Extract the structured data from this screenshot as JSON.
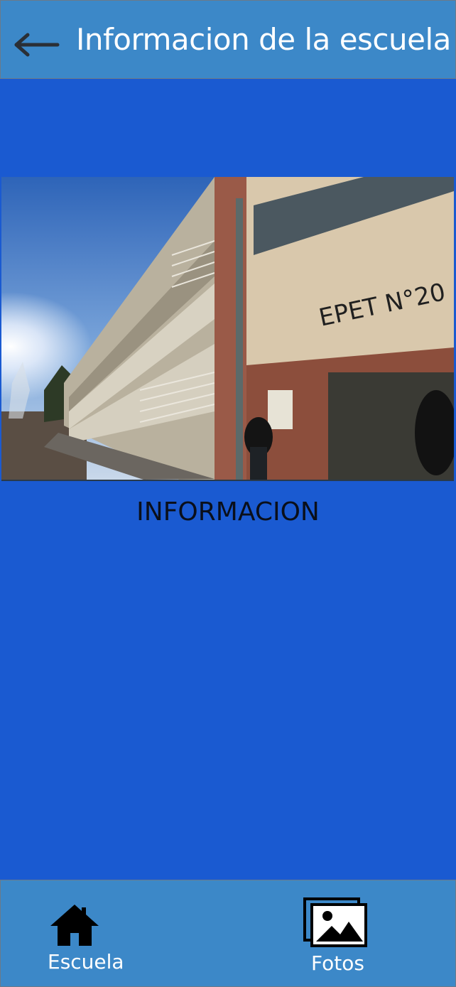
{
  "header": {
    "title": "Informacion de la escuela",
    "back_icon": "arrow-left-icon"
  },
  "main": {
    "photo_alt": "School building photo",
    "photo_sign": "EPET N°20",
    "section_title": "INFORMACION"
  },
  "bottom_nav": {
    "items": [
      {
        "label": "Escuela",
        "icon": "home-icon"
      },
      {
        "label": "Fotos",
        "icon": "photos-icon"
      }
    ]
  },
  "colors": {
    "header_bg": "#3c88c8",
    "body_bg": "#1a5ad1",
    "nav_bg": "#3c88c8"
  }
}
